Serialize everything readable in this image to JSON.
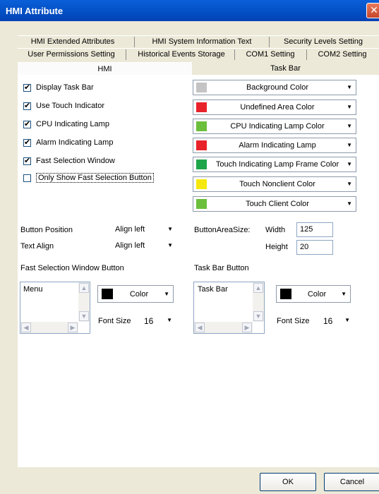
{
  "window": {
    "title": "HMI Attribute",
    "close_glyph": "✕"
  },
  "tabs_row1": [
    "HMI Extended Attributes",
    "HMI System Information Text",
    "Security Levels Setting"
  ],
  "tabs_row2": [
    "User Permissions Setting",
    "Historical Events Storage",
    "COM1 Setting",
    "COM2 Setting"
  ],
  "sections": {
    "hmi": "HMI",
    "taskbar": "Task Bar"
  },
  "checkboxes": [
    {
      "label": "Display Task Bar",
      "checked": true
    },
    {
      "label": "Use Touch Indicator",
      "checked": true
    },
    {
      "label": "CPU Indicating Lamp",
      "checked": true
    },
    {
      "label": "Alarm Indicating Lamp",
      "checked": true
    },
    {
      "label": "Fast Selection Window",
      "checked": true
    },
    {
      "label": "Only Show Fast Selection Button",
      "checked": false
    }
  ],
  "check_glyph": "✔",
  "dropdown_glyph": "▼",
  "color_buttons": [
    {
      "label": "Background Color",
      "color": "#c4c4c4"
    },
    {
      "label": "Undefined Area Color",
      "color": "#e8222a"
    },
    {
      "label": "CPU Indicating Lamp Color",
      "color": "#6cbf3c"
    },
    {
      "label": "Alarm Indicating Lamp",
      "color": "#e8222a"
    },
    {
      "label": "Touch Indicating Lamp Frame Color",
      "color": "#1ea54a"
    },
    {
      "label": "Touch Nonclient Color",
      "color": "#f5e80e"
    },
    {
      "label": "Touch Client Color",
      "color": "#6cbf3c"
    }
  ],
  "button_position": {
    "label": "Button Position",
    "value": "Align left"
  },
  "text_align": {
    "label": "Text Align",
    "value": "Align left"
  },
  "button_area": {
    "label": "ButtonAreaSize:",
    "width_label": "Width",
    "width_value": "125",
    "height_label": "Height",
    "height_value": "20"
  },
  "fast_selection": {
    "title": "Fast Selection Window Button",
    "list_item": "Menu",
    "color_label": "Color",
    "color": "#000000",
    "font_size_label": "Font Size",
    "font_size_value": "16"
  },
  "task_bar_button": {
    "title": "Task Bar Button",
    "list_item": "Task Bar",
    "color_label": "Color",
    "color": "#000000",
    "font_size_label": "Font Size",
    "font_size_value": "16"
  },
  "scroll_glyphs": {
    "up": "▲",
    "down": "▼",
    "left": "◀",
    "right": "▶"
  },
  "buttons": {
    "ok": "OK",
    "cancel": "Cancel"
  }
}
